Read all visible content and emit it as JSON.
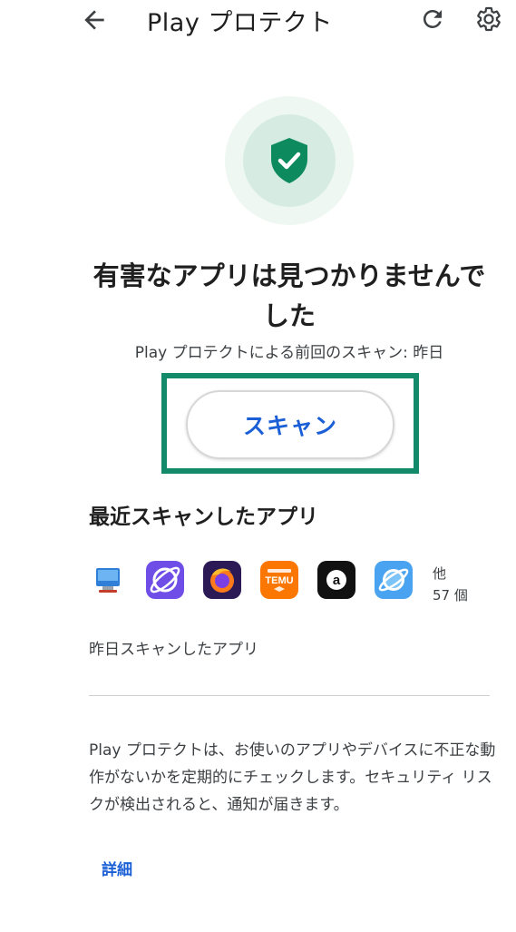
{
  "app_bar": {
    "title": "Play プロテクト",
    "back_icon": "arrow-back-icon",
    "refresh_icon": "refresh-icon",
    "settings_icon": "gear-icon"
  },
  "status": {
    "icon": "shield-check-icon",
    "headline_line1": "有害なアプリは見つかりませんで",
    "headline_line2": "した",
    "last_scan": "Play プロテクトによる前回のスキャン: 昨日"
  },
  "scan_button_label": "スキャン",
  "recent": {
    "title": "最近スキャンしたアプリ",
    "apps": [
      {
        "icon": "remote-desktop-app-icon",
        "color": "#2f7fd9"
      },
      {
        "icon": "planet-browser-app-icon",
        "color": "#6f4ee8"
      },
      {
        "icon": "firefox-app-icon",
        "color": "#2b1a55"
      },
      {
        "icon": "temu-app-icon",
        "label": "TEMU",
        "color": "#fb7701"
      },
      {
        "icon": "a-letter-app-icon",
        "label": "a",
        "color": "#111111"
      },
      {
        "icon": "planet-blue-app-icon",
        "color": "#4aa3f0"
      }
    ],
    "others_prefix": "他",
    "others_count": "57 個",
    "scanned_label": "昨日スキャンしたアプリ"
  },
  "info": {
    "description": "Play プロテクトは、お使いのアプリやデバイスに不正な動作がないかを定期的にチェックします。セキュリティ リスクが検出されると、通知が届きます。",
    "details_link": "詳細"
  },
  "colors": {
    "accent_green": "#138a6a",
    "link_blue": "#1a5fd6"
  }
}
